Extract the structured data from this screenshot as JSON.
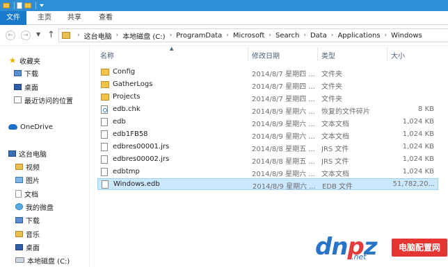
{
  "ribbon": {
    "file_tab": "文件",
    "tabs": [
      "主页",
      "共享",
      "查看"
    ]
  },
  "address": {
    "crumbs": [
      "这台电脑",
      "本地磁盘 (C:)",
      "ProgramData",
      "Microsoft",
      "Search",
      "Data",
      "Applications",
      "Windows"
    ]
  },
  "nav": {
    "favorites": "收藏夹",
    "downloads": "下载",
    "desktop": "桌面",
    "recent": "最近访问的位置",
    "onedrive": "OneDrive",
    "this_pc": "这台电脑",
    "videos": "视频",
    "pictures": "图片",
    "documents": "文档",
    "wechat": "我的微盘",
    "downloads2": "下载",
    "music": "音乐",
    "desktop2": "桌面",
    "local_disk": "本地磁盘 (C:)"
  },
  "columns": {
    "name": "名称",
    "date": "修改日期",
    "type": "类型",
    "size": "大小"
  },
  "files": [
    {
      "name": "Config",
      "date": "2014/8/7 星期四 ...",
      "type": "文件夹",
      "size": "",
      "icon": "folder"
    },
    {
      "name": "GatherLogs",
      "date": "2014/8/7 星期四 ...",
      "type": "文件夹",
      "size": "",
      "icon": "folder"
    },
    {
      "name": "Projects",
      "date": "2014/8/7 星期四 ...",
      "type": "文件夹",
      "size": "",
      "icon": "folder"
    },
    {
      "name": "edb.chk",
      "date": "2014/8/9 星期六 ...",
      "type": "恢复的文件碎片",
      "size": "8 KB",
      "icon": "chk"
    },
    {
      "name": "edb",
      "date": "2014/8/9 星期六 ...",
      "type": "文本文档",
      "size": "1,024 KB",
      "icon": "file"
    },
    {
      "name": "edb1FB58",
      "date": "2014/8/9 星期六 ...",
      "type": "文本文档",
      "size": "1,024 KB",
      "icon": "file"
    },
    {
      "name": "edbres00001.jrs",
      "date": "2014/8/8 星期五 ...",
      "type": "JRS 文件",
      "size": "1,024 KB",
      "icon": "file"
    },
    {
      "name": "edbres00002.jrs",
      "date": "2014/8/8 星期五 ...",
      "type": "JRS 文件",
      "size": "1,024 KB",
      "icon": "file"
    },
    {
      "name": "edbtmp",
      "date": "2014/8/9 星期六 ...",
      "type": "文本文档",
      "size": "1,024 KB",
      "icon": "file"
    },
    {
      "name": "Windows.edb",
      "date": "2014/8/9 星期六 ...",
      "type": "EDB 文件",
      "size": "51,782,20...",
      "icon": "file",
      "selected": true
    }
  ],
  "watermark": {
    "logo": "dnpz",
    "domain": ".net",
    "site": "电脑配置网"
  }
}
